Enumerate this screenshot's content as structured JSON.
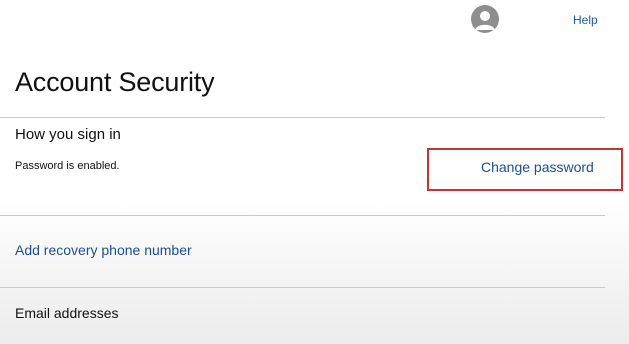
{
  "header": {
    "avatar_icon": "user-avatar-icon",
    "help_label": "Help"
  },
  "page": {
    "title": "Account Security"
  },
  "sign_in": {
    "heading": "How you sign in",
    "status": "Password is enabled.",
    "change_password_label": "Change password"
  },
  "recovery": {
    "add_phone_label": "Add recovery phone number"
  },
  "email": {
    "heading": "Email addresses"
  },
  "colors": {
    "link": "#1a4f94",
    "highlight": "#c83232",
    "avatar": "#8e8e8e"
  }
}
